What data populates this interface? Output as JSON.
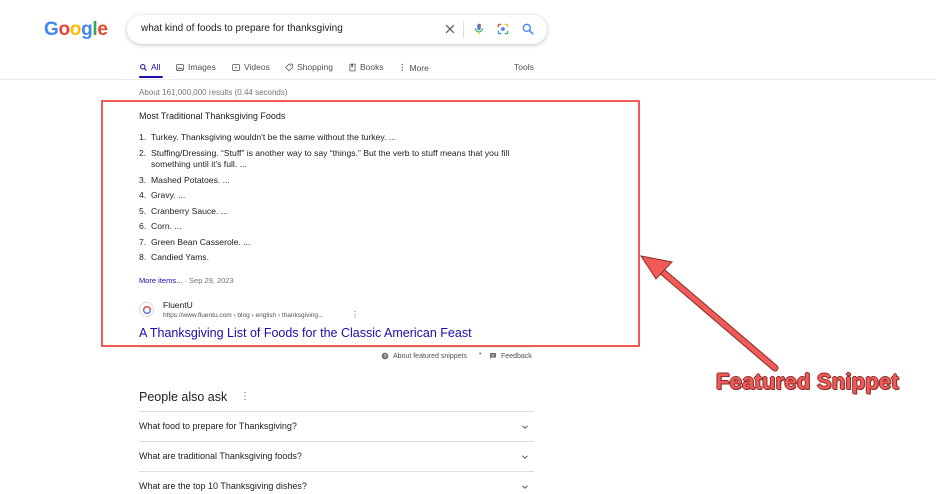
{
  "header": {
    "logo_letters": [
      {
        "char": "G",
        "color": "#4285F4"
      },
      {
        "char": "o",
        "color": "#EA4335"
      },
      {
        "char": "o",
        "color": "#FBBC05"
      },
      {
        "char": "g",
        "color": "#4285F4"
      },
      {
        "char": "l",
        "color": "#34A853"
      },
      {
        "char": "e",
        "color": "#EA4335"
      }
    ],
    "search_query": "what kind of foods to prepare for thanksgiving",
    "icons": [
      "clear-icon",
      "microphone-icon",
      "lens-icon",
      "search-icon"
    ]
  },
  "tabs": {
    "items": [
      {
        "label": "All",
        "icon": "search-icon",
        "active": true
      },
      {
        "label": "Images",
        "icon": "image-icon",
        "active": false
      },
      {
        "label": "Videos",
        "icon": "video-icon",
        "active": false
      },
      {
        "label": "Shopping",
        "icon": "tag-icon",
        "active": false
      },
      {
        "label": "Books",
        "icon": "book-icon",
        "active": false
      },
      {
        "label": "More",
        "icon": "more-vert-icon",
        "active": false
      }
    ],
    "tools_label": "Tools"
  },
  "results_stats": "About 161,000,000 results (0.44 seconds)",
  "featured_snippet": {
    "title": "Most Traditional Thanksgiving Foods",
    "items": [
      {
        "num": "1.",
        "text": "Turkey. Thanksgiving wouldn't be the same without the turkey. ..."
      },
      {
        "num": "2.",
        "text": "Stuffing/Dressing. “Stuff” is another way to say “things.” But the verb to stuff means that you fill something until it's full. ..."
      },
      {
        "num": "3.",
        "text": "Mashed Potatoes. ..."
      },
      {
        "num": "4.",
        "text": "Gravy. ..."
      },
      {
        "num": "5.",
        "text": "Cranberry Sauce. ..."
      },
      {
        "num": "6.",
        "text": "Corn. ..."
      },
      {
        "num": "7.",
        "text": "Green Bean Casserole. ..."
      },
      {
        "num": "8.",
        "text": "Candied Yams."
      }
    ],
    "more_items_label": "More items...",
    "date": "Sep 29, 2023",
    "source_name": "FluentU",
    "source_url": "https://www.fluentu.com › blog › english › thanksgiving...",
    "result_title": "A Thanksgiving List of Foods for the Classic American Feast",
    "about_label": "About featured snippets",
    "feedback_label": "Feedback"
  },
  "people_also_ask": {
    "title": "People also ask",
    "questions": [
      "What food to prepare for Thanksgiving?",
      "What are traditional Thanksgiving foods?",
      "What are the top 10 Thanksgiving dishes?"
    ]
  },
  "annotation": {
    "label": "Featured Snippet",
    "color": "#f05a57"
  }
}
